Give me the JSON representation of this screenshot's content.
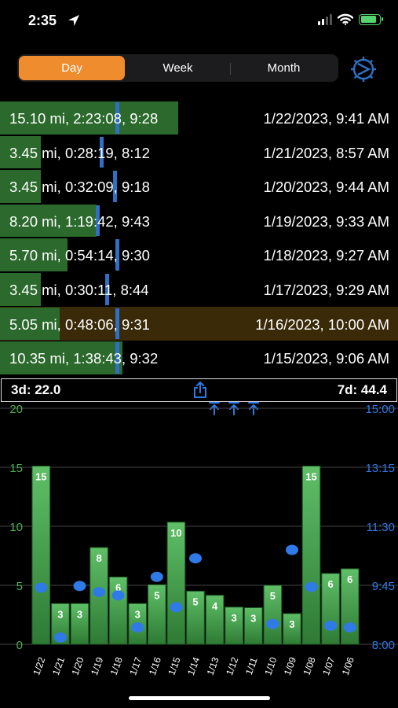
{
  "status_bar": {
    "time": "2:35"
  },
  "segment": {
    "tabs": [
      "Day",
      "Week",
      "Month"
    ],
    "selected": "Day"
  },
  "runs": [
    {
      "summary": "15.10 mi, 2:23:08, 9:28",
      "datetime": "1/22/2023, 9:41 AM",
      "distance_mi": 15.1,
      "marker": 0.29,
      "highlight": false
    },
    {
      "summary": "3.45 mi, 0:28:19, 8:12",
      "datetime": "1/21/2023, 8:57 AM",
      "distance_mi": 3.45,
      "marker": 0.25,
      "highlight": false
    },
    {
      "summary": "3.45 mi, 0:32:09, 9:18",
      "datetime": "1/20/2023, 9:44 AM",
      "distance_mi": 3.45,
      "marker": 0.285,
      "highlight": false
    },
    {
      "summary": "8.20 mi, 1:19:42, 9:43",
      "datetime": "1/19/2023, 9:33 AM",
      "distance_mi": 8.2,
      "marker": 0.24,
      "highlight": false
    },
    {
      "summary": "5.70 mi, 0:54:14, 9:30",
      "datetime": "1/18/2023, 9:27 AM",
      "distance_mi": 5.7,
      "marker": 0.29,
      "highlight": false
    },
    {
      "summary": "3.45 mi, 0:30:11, 8:44",
      "datetime": "1/17/2023, 9:29 AM",
      "distance_mi": 3.45,
      "marker": 0.265,
      "highlight": false
    },
    {
      "summary": "5.05 mi, 0:48:06, 9:31",
      "datetime": "1/16/2023, 10:00 AM",
      "distance_mi": 5.05,
      "marker": 0.29,
      "highlight": true
    },
    {
      "summary": "10.35 mi, 1:38:43, 9:32",
      "datetime": "1/15/2023, 9:06 AM",
      "distance_mi": 10.35,
      "marker": 0.29,
      "highlight": false
    }
  ],
  "summary_bar": {
    "three_day": "3d:  22.0",
    "seven_day": "7d:  44.4"
  },
  "colors": {
    "accent": "#ef8c2e",
    "blue": "#2f6fc4",
    "bar_green": "#2b6a2c",
    "chart_green": "#56b05e",
    "highlight": "#3a2a08"
  },
  "chart_data": {
    "type": "bar",
    "categories": [
      "1/22",
      "1/21",
      "1/20",
      "1/19",
      "1/18",
      "1/17",
      "1/16",
      "1/15",
      "1/14",
      "1/13",
      "1/12",
      "1/11",
      "1/10",
      "1/09",
      "1/08",
      "1/07",
      "1/06"
    ],
    "series": [
      {
        "values": [
          15.1,
          3.45,
          3.45,
          8.2,
          5.7,
          3.45,
          5.05,
          10.35,
          4.5,
          4.15,
          3.15,
          3.1,
          5.0,
          2.6,
          15.1,
          6.0,
          6.4
        ]
      }
    ],
    "data_labels": [
      "15",
      "3",
      "3",
      "8",
      "6",
      "3",
      "5",
      "10",
      "5",
      "4",
      "3",
      "3",
      "5",
      "3",
      "15",
      "6",
      "6"
    ],
    "start_time_hours": [
      9.68,
      8.2,
      9.73,
      9.55,
      9.45,
      8.5,
      10.0,
      9.1,
      10.55,
      null,
      null,
      null,
      8.6,
      10.8,
      9.7,
      8.55,
      8.5
    ],
    "y_left": {
      "min": 0,
      "max": 20,
      "ticks": [
        "0",
        "5",
        "10",
        "15",
        "20"
      ]
    },
    "y_right": {
      "min": 8,
      "max": 15,
      "ticks": [
        "8:00",
        "9:45",
        "11:30",
        "13:15",
        "15:00"
      ]
    }
  }
}
